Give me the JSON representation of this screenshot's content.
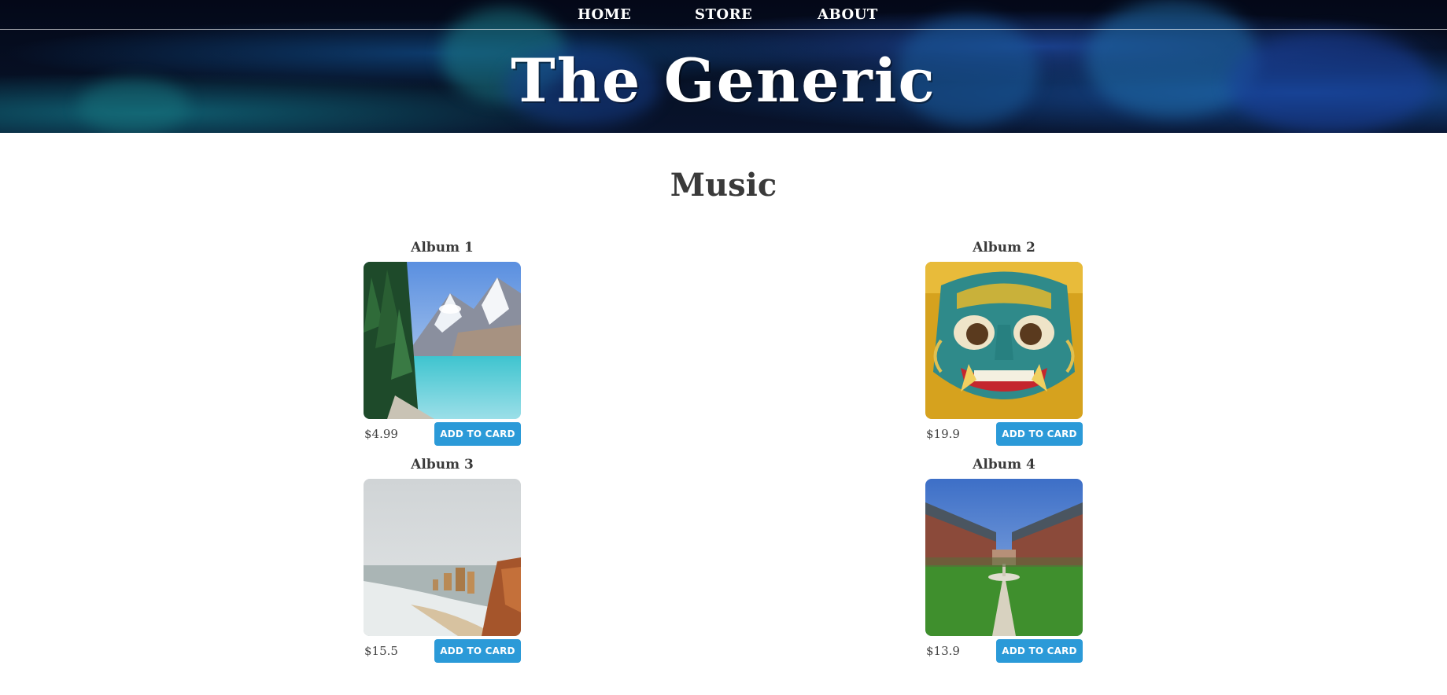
{
  "nav": {
    "links": [
      "HOME",
      "STORE",
      "ABOUT"
    ]
  },
  "site_title": "The Generic",
  "section": {
    "title": "Music"
  },
  "albums": [
    {
      "title": "Album 1",
      "price": "$4.99",
      "button": "ADD TO CARD",
      "image": "lake-mountains"
    },
    {
      "title": "Album 2",
      "price": "$19.9",
      "button": "ADD TO CARD",
      "image": "thai-mask"
    },
    {
      "title": "Album 3",
      "price": "$15.5",
      "button": "ADD TO CARD",
      "image": "coastal-cliffs"
    },
    {
      "title": "Album 4",
      "price": "$13.9",
      "button": "ADD TO CARD",
      "image": "plaza-courtyard"
    }
  ],
  "colors": {
    "header_bg": "#061024",
    "button": "#2b9ad8",
    "heading": "#3a3a3a"
  }
}
